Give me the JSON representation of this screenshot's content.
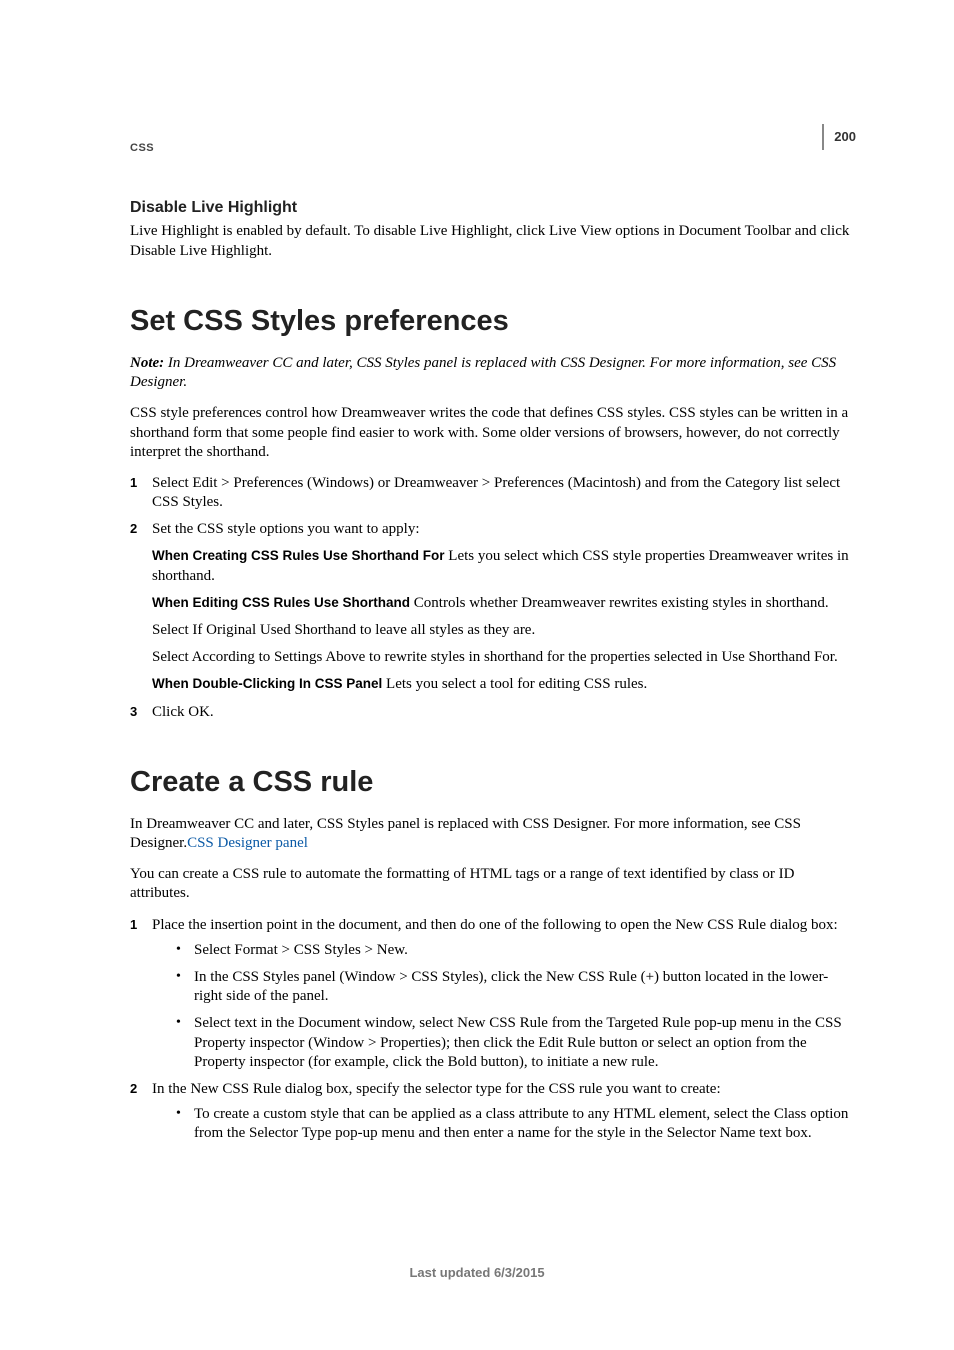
{
  "runningHead": "CSS",
  "pageNumber": "200",
  "sectionA": {
    "subhead": "Disable Live Highlight",
    "para": "Live Highlight is enabled by default. To disable Live Highlight, click Live View options in Document Toolbar and click Disable Live Highlight."
  },
  "sectionB": {
    "title": "Set CSS Styles preferences",
    "noteLabel": "Note: ",
    "noteBody": "In Dreamweaver CC and later, CSS Styles panel is replaced with CSS Designer. For more information, see CSS Designer.",
    "intro": "CSS style preferences control how Dreamweaver writes the code that defines CSS styles. CSS styles can be written in a shorthand form that some people find easier to work with. Some older versions of browsers, however, do not correctly interpret the shorthand.",
    "step1": {
      "num": "1",
      "text": "Select Edit > Preferences (Windows) or Dreamweaver > Preferences (Macintosh) and from the Category list select CSS Styles."
    },
    "step2": {
      "num": "2",
      "text": "Set the CSS style options you want to apply:",
      "def1Label": "When Creating CSS Rules Use Shorthand For ",
      "def1Body": " Lets you select which CSS style properties Dreamweaver writes in shorthand.",
      "def2Label": "When Editing CSS Rules Use Shorthand ",
      "def2Body": " Controls whether Dreamweaver rewrites existing styles in shorthand.",
      "p1": "Select If Original Used Shorthand to leave all styles as they are.",
      "p2": "Select According to Settings Above to rewrite styles in shorthand for the properties selected in Use Shorthand For.",
      "def3Label": "When Double-Clicking In CSS Panel ",
      "def3Body": " Lets you select a tool for editing CSS rules."
    },
    "step3": {
      "num": "3",
      "text": "Click OK."
    }
  },
  "sectionC": {
    "title": "Create a CSS rule",
    "intro1a": "In Dreamweaver CC and later, CSS Styles panel is replaced with CSS Designer. For more information, see CSS Designer.",
    "link": "CSS Designer panel",
    "intro2": "You can create a CSS rule to automate the formatting of HTML tags or a range of text identified by class or ID attributes.",
    "step1": {
      "num": "1",
      "text": "Place the insertion point in the document, and then do one of the following to open the New CSS Rule dialog box:",
      "b1": "Select Format > CSS Styles > New.",
      "b2": "In the CSS Styles panel (Window > CSS Styles), click the New CSS Rule (+) button located in the lower-right side of the panel.",
      "b3": "Select text in the Document window, select New CSS Rule from the Targeted Rule pop-up menu in the CSS Property inspector (Window > Properties); then click the Edit Rule button or select an option from the Property inspector (for example, click the Bold button), to initiate a new rule."
    },
    "step2": {
      "num": "2",
      "text": "In the New CSS Rule dialog box, specify the selector type for the CSS rule you want to create:",
      "b1": "To create a custom style that can be applied as a class attribute to any HTML element, select the Class option from the Selector Type pop-up menu and then enter a name for the style in the Selector Name text box."
    }
  },
  "footer": "Last updated 6/3/2015"
}
